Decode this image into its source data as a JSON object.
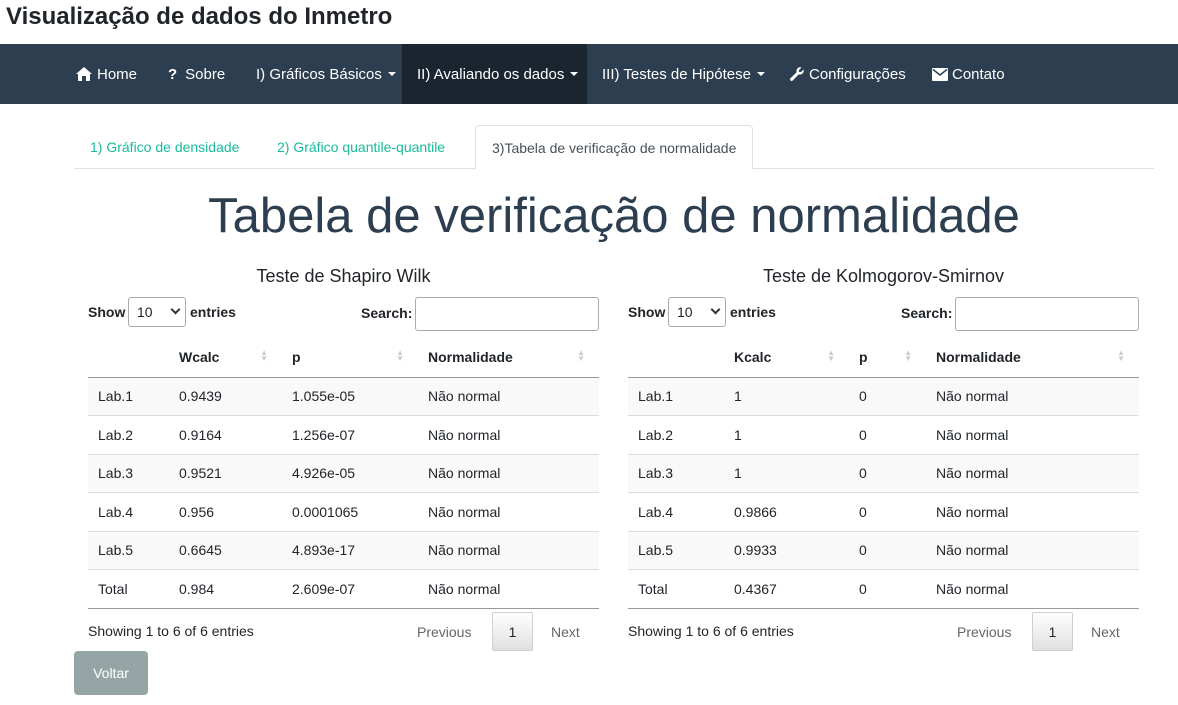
{
  "app_title": "Visualização de dados do Inmetro",
  "nav": {
    "home": "Home",
    "sobre": "Sobre",
    "graficos_basicos": "I) Gráficos Básicos",
    "avaliando": "II) Avaliando os dados",
    "testes": "III) Testes de Hipótese",
    "config": "Configurações",
    "contato": "Contato"
  },
  "tabs": [
    {
      "label": "1) Gráfico de densidade"
    },
    {
      "label": "2) Gráfico quantile-quantile"
    },
    {
      "label": "3)Tabela de verificação de normalidade"
    }
  ],
  "page_title": "Tabela de verificação de normalidade",
  "left": {
    "title": "Teste de Shapiro Wilk",
    "show_label": "Show",
    "entries_label": "entries",
    "length_value": "10",
    "search_label": "Search:",
    "search_value": "",
    "columns": [
      "",
      "Wcalc",
      "p",
      "Normalidade"
    ],
    "rows": [
      [
        "Lab.1",
        "0.9439",
        "1.055e-05",
        "Não normal"
      ],
      [
        "Lab.2",
        "0.9164",
        "1.256e-07",
        "Não normal"
      ],
      [
        "Lab.3",
        "0.9521",
        "4.926e-05",
        "Não normal"
      ],
      [
        "Lab.4",
        "0.956",
        "0.0001065",
        "Não normal"
      ],
      [
        "Lab.5",
        "0.6645",
        "4.893e-17",
        "Não normal"
      ],
      [
        "Total",
        "0.984",
        "2.609e-07",
        "Não normal"
      ]
    ],
    "info": "Showing 1 to 6 of 6 entries",
    "prev": "Previous",
    "page": "1",
    "next": "Next"
  },
  "right": {
    "title": "Teste de Kolmogorov-Smirnov",
    "show_label": "Show",
    "entries_label": "entries",
    "length_value": "10",
    "search_label": "Search:",
    "search_value": "",
    "columns": [
      "",
      "Kcalc",
      "p",
      "Normalidade"
    ],
    "rows": [
      [
        "Lab.1",
        "1",
        "0",
        "Não normal"
      ],
      [
        "Lab.2",
        "1",
        "0",
        "Não normal"
      ],
      [
        "Lab.3",
        "1",
        "0",
        "Não normal"
      ],
      [
        "Lab.4",
        "0.9866",
        "0",
        "Não normal"
      ],
      [
        "Lab.5",
        "0.9933",
        "0",
        "Não normal"
      ],
      [
        "Total",
        "0.4367",
        "0",
        "Não normal"
      ]
    ],
    "info": "Showing 1 to 6 of 6 entries",
    "prev": "Previous",
    "page": "1",
    "next": "Next"
  },
  "back_button": "Voltar",
  "colors": {
    "navbar": "#2c3e50",
    "navbar_active": "#1a252f",
    "tab_link": "#18bc9c",
    "title": "#2c3e50",
    "back_button": "#95a5a6"
  }
}
